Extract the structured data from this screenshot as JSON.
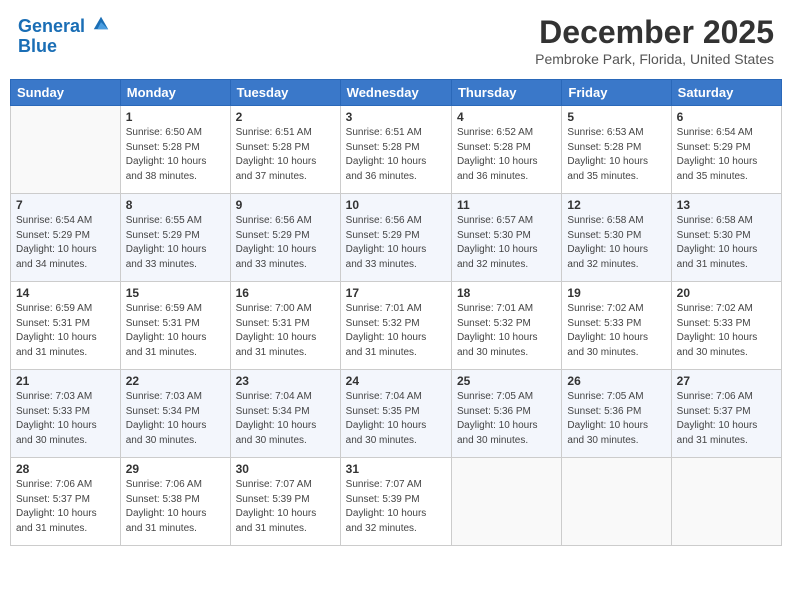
{
  "header": {
    "logo_line1": "General",
    "logo_line2": "Blue",
    "month_title": "December 2025",
    "location": "Pembroke Park, Florida, United States"
  },
  "weekdays": [
    "Sunday",
    "Monday",
    "Tuesday",
    "Wednesday",
    "Thursday",
    "Friday",
    "Saturday"
  ],
  "weeks": [
    [
      {
        "day": "",
        "info": ""
      },
      {
        "day": "1",
        "info": "Sunrise: 6:50 AM\nSunset: 5:28 PM\nDaylight: 10 hours\nand 38 minutes."
      },
      {
        "day": "2",
        "info": "Sunrise: 6:51 AM\nSunset: 5:28 PM\nDaylight: 10 hours\nand 37 minutes."
      },
      {
        "day": "3",
        "info": "Sunrise: 6:51 AM\nSunset: 5:28 PM\nDaylight: 10 hours\nand 36 minutes."
      },
      {
        "day": "4",
        "info": "Sunrise: 6:52 AM\nSunset: 5:28 PM\nDaylight: 10 hours\nand 36 minutes."
      },
      {
        "day": "5",
        "info": "Sunrise: 6:53 AM\nSunset: 5:28 PM\nDaylight: 10 hours\nand 35 minutes."
      },
      {
        "day": "6",
        "info": "Sunrise: 6:54 AM\nSunset: 5:29 PM\nDaylight: 10 hours\nand 35 minutes."
      }
    ],
    [
      {
        "day": "7",
        "info": "Sunrise: 6:54 AM\nSunset: 5:29 PM\nDaylight: 10 hours\nand 34 minutes."
      },
      {
        "day": "8",
        "info": "Sunrise: 6:55 AM\nSunset: 5:29 PM\nDaylight: 10 hours\nand 33 minutes."
      },
      {
        "day": "9",
        "info": "Sunrise: 6:56 AM\nSunset: 5:29 PM\nDaylight: 10 hours\nand 33 minutes."
      },
      {
        "day": "10",
        "info": "Sunrise: 6:56 AM\nSunset: 5:29 PM\nDaylight: 10 hours\nand 33 minutes."
      },
      {
        "day": "11",
        "info": "Sunrise: 6:57 AM\nSunset: 5:30 PM\nDaylight: 10 hours\nand 32 minutes."
      },
      {
        "day": "12",
        "info": "Sunrise: 6:58 AM\nSunset: 5:30 PM\nDaylight: 10 hours\nand 32 minutes."
      },
      {
        "day": "13",
        "info": "Sunrise: 6:58 AM\nSunset: 5:30 PM\nDaylight: 10 hours\nand 31 minutes."
      }
    ],
    [
      {
        "day": "14",
        "info": "Sunrise: 6:59 AM\nSunset: 5:31 PM\nDaylight: 10 hours\nand 31 minutes."
      },
      {
        "day": "15",
        "info": "Sunrise: 6:59 AM\nSunset: 5:31 PM\nDaylight: 10 hours\nand 31 minutes."
      },
      {
        "day": "16",
        "info": "Sunrise: 7:00 AM\nSunset: 5:31 PM\nDaylight: 10 hours\nand 31 minutes."
      },
      {
        "day": "17",
        "info": "Sunrise: 7:01 AM\nSunset: 5:32 PM\nDaylight: 10 hours\nand 31 minutes."
      },
      {
        "day": "18",
        "info": "Sunrise: 7:01 AM\nSunset: 5:32 PM\nDaylight: 10 hours\nand 30 minutes."
      },
      {
        "day": "19",
        "info": "Sunrise: 7:02 AM\nSunset: 5:33 PM\nDaylight: 10 hours\nand 30 minutes."
      },
      {
        "day": "20",
        "info": "Sunrise: 7:02 AM\nSunset: 5:33 PM\nDaylight: 10 hours\nand 30 minutes."
      }
    ],
    [
      {
        "day": "21",
        "info": "Sunrise: 7:03 AM\nSunset: 5:33 PM\nDaylight: 10 hours\nand 30 minutes."
      },
      {
        "day": "22",
        "info": "Sunrise: 7:03 AM\nSunset: 5:34 PM\nDaylight: 10 hours\nand 30 minutes."
      },
      {
        "day": "23",
        "info": "Sunrise: 7:04 AM\nSunset: 5:34 PM\nDaylight: 10 hours\nand 30 minutes."
      },
      {
        "day": "24",
        "info": "Sunrise: 7:04 AM\nSunset: 5:35 PM\nDaylight: 10 hours\nand 30 minutes."
      },
      {
        "day": "25",
        "info": "Sunrise: 7:05 AM\nSunset: 5:36 PM\nDaylight: 10 hours\nand 30 minutes."
      },
      {
        "day": "26",
        "info": "Sunrise: 7:05 AM\nSunset: 5:36 PM\nDaylight: 10 hours\nand 30 minutes."
      },
      {
        "day": "27",
        "info": "Sunrise: 7:06 AM\nSunset: 5:37 PM\nDaylight: 10 hours\nand 31 minutes."
      }
    ],
    [
      {
        "day": "28",
        "info": "Sunrise: 7:06 AM\nSunset: 5:37 PM\nDaylight: 10 hours\nand 31 minutes."
      },
      {
        "day": "29",
        "info": "Sunrise: 7:06 AM\nSunset: 5:38 PM\nDaylight: 10 hours\nand 31 minutes."
      },
      {
        "day": "30",
        "info": "Sunrise: 7:07 AM\nSunset: 5:39 PM\nDaylight: 10 hours\nand 31 minutes."
      },
      {
        "day": "31",
        "info": "Sunrise: 7:07 AM\nSunset: 5:39 PM\nDaylight: 10 hours\nand 32 minutes."
      },
      {
        "day": "",
        "info": ""
      },
      {
        "day": "",
        "info": ""
      },
      {
        "day": "",
        "info": ""
      }
    ]
  ]
}
